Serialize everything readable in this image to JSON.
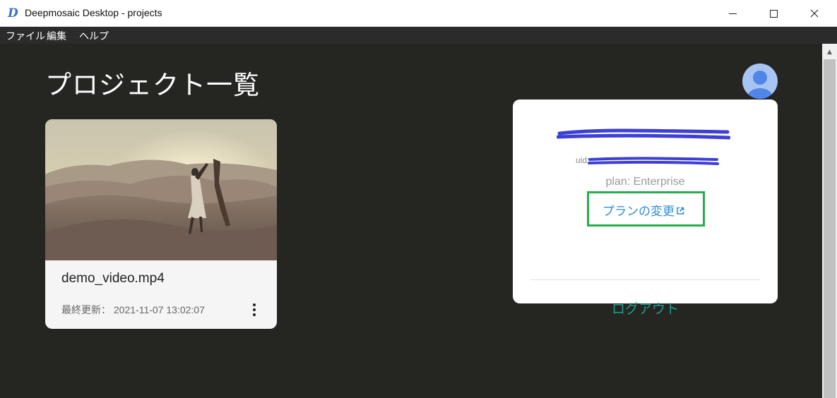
{
  "window": {
    "title": "Deepmosaic Desktop - projects",
    "logo_letter": "D"
  },
  "menu": {
    "items": [
      "ファイル",
      "編集",
      "ヘルプ"
    ]
  },
  "page": {
    "title": "プロジェクト一覧"
  },
  "projects": [
    {
      "name": "demo_video.mp4",
      "updated_label": "最終更新：",
      "updated_value": "2021-11-07 13:02:07"
    }
  ],
  "account": {
    "uid_label": "uid:",
    "plan": "plan: Enterprise",
    "change_plan_label": "プランの変更",
    "logout_label": "ログアウト"
  },
  "colors": {
    "app_background": "#252522",
    "menubar": "#2b2b2b",
    "highlight_box": "#27ad4e",
    "link": "#2f8fd1",
    "logout": "#1f9d91",
    "redaction": "#3d3fd6"
  },
  "icons": [
    "deepmosaic-logo-icon",
    "minimize-icon",
    "maximize-icon",
    "close-icon",
    "more-vert-icon",
    "avatar-icon",
    "external-link-icon",
    "scroll-up-icon"
  ]
}
